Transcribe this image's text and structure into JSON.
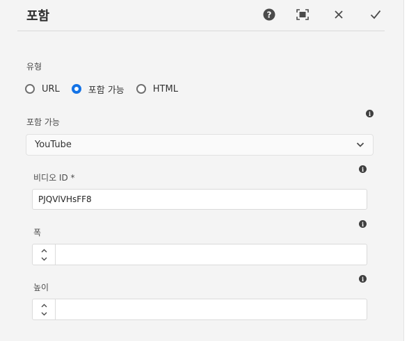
{
  "dialog": {
    "title": "포함",
    "help_icon": "help-icon",
    "fullscreen_icon": "fullscreen-icon",
    "close_icon": "close-icon",
    "done_icon": "checkmark-icon"
  },
  "type_group": {
    "label": "유형",
    "options": [
      {
        "label": "URL",
        "checked": false
      },
      {
        "label": "포함 가능",
        "checked": true
      },
      {
        "label": "HTML",
        "checked": false
      }
    ]
  },
  "embeddable": {
    "label": "포함 가능",
    "selected": "YouTube",
    "info_icon": "info-icon"
  },
  "video_id": {
    "label": "비디오 ID *",
    "value": "PJQVlVHsFF8",
    "info_icon": "info-icon"
  },
  "width": {
    "label": "폭",
    "value": "",
    "info_icon": "info-icon"
  },
  "height": {
    "label": "높이",
    "value": "",
    "info_icon": "info-icon"
  },
  "colors": {
    "accent": "#1473e6",
    "panel_bg": "#f4f4f4"
  }
}
